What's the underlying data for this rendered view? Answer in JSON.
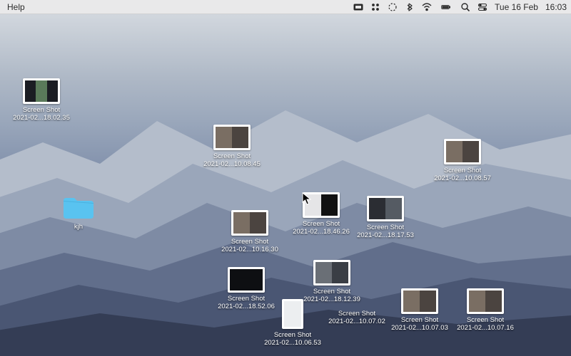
{
  "menubar": {
    "left": {
      "help": "Help"
    },
    "right": {
      "date": "Tue 16 Feb",
      "time": "16:03"
    },
    "icons": {
      "input": "input-source-icon",
      "assistant": "assistant-icon",
      "sync": "sync-icon",
      "bluetooth": "bluetooth-icon",
      "wifi": "wifi-icon",
      "battery": "battery-icon",
      "search": "search-icon",
      "control": "control-center-icon"
    }
  },
  "items": {
    "i0": {
      "label": "Screen Shot\n2021-02...18.02.35"
    },
    "i1": {
      "label": "Screen Shot\n2021-02...10.08.45"
    },
    "i2": {
      "label": "Screen Shot\n2021-02...10.08.57"
    },
    "i3": {
      "label": "kjh"
    },
    "i4": {
      "label": "Screen Shot\n2021-02...18.46.26"
    },
    "i5": {
      "label": "Screen Shot\n2021-02...18.17.53"
    },
    "i6": {
      "label": "Screen Shot\n2021-02...10.16.30"
    },
    "i7": {
      "label": "Screen Shot\n2021-02...18.52.06"
    },
    "i8": {
      "label": "Screen Shot\n2021-02...18.12.39"
    },
    "i9": {
      "label": "Screen Shot\n2021-02...10.06.53"
    },
    "i10": {
      "label": "Screen Shot\n2021-02...10.07.02"
    },
    "i11": {
      "label": "Screen Shot\n2021-02...10.07.03"
    },
    "i12": {
      "label": "Screen Shot\n2021-02...10.07.16"
    }
  }
}
